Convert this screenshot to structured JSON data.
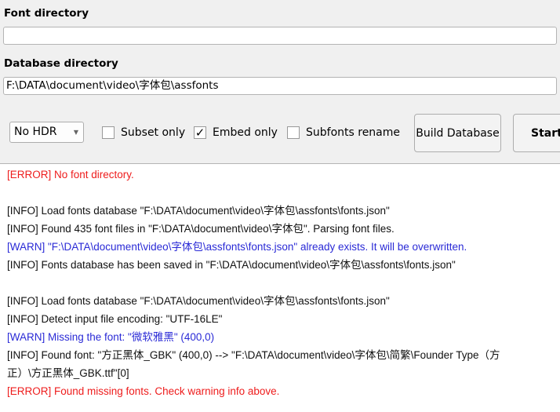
{
  "font_dir": {
    "label": "Font directory",
    "value": ""
  },
  "db_dir": {
    "label": "Database directory",
    "value": "F:\\DATA\\document\\video\\字体包\\assfonts"
  },
  "hdr": {
    "selected": "No HDR"
  },
  "options": [
    {
      "label": "Subset only",
      "checked": false
    },
    {
      "label": "Embed only",
      "checked": true
    },
    {
      "label": "Subfonts rename",
      "checked": false
    }
  ],
  "buttons": {
    "build": "Build Database",
    "start": "Start"
  },
  "colors": {
    "error": "#ee1c1c",
    "warn": "#2a2ad6"
  },
  "log": [
    {
      "level": "ERROR",
      "text": "[ERROR] No font directory."
    },
    {
      "level": "INFO",
      "text": ""
    },
    {
      "level": "INFO",
      "text": "[INFO] Load fonts database \"F:\\DATA\\document\\video\\字体包\\assfonts\\fonts.json\""
    },
    {
      "level": "INFO",
      "text": "[INFO] Found 435 font files in \"F:\\DATA\\document\\video\\字体包\". Parsing font files."
    },
    {
      "level": "WARN",
      "text": "[WARN] \"F:\\DATA\\document\\video\\字体包\\assfonts\\fonts.json\" already exists. It will be overwritten."
    },
    {
      "level": "INFO",
      "text": "[INFO] Fonts database has been saved in \"F:\\DATA\\document\\video\\字体包\\assfonts\\fonts.json\""
    },
    {
      "level": "INFO",
      "text": ""
    },
    {
      "level": "INFO",
      "text": "[INFO] Load fonts database \"F:\\DATA\\document\\video\\字体包\\assfonts\\fonts.json\""
    },
    {
      "level": "INFO",
      "text": "[INFO] Detect input file encoding:  \"UTF-16LE\""
    },
    {
      "level": "WARN",
      "text": "[WARN] Missing the font: \"微软雅黑\" (400,0)"
    },
    {
      "level": "INFO",
      "text": "[INFO] Found font: \"方正黑体_GBK\" (400,0) --> \"F:\\DATA\\document\\video\\字体包\\简繁\\Founder Type（方"
    },
    {
      "level": "INFO",
      "text": "正）\\方正黑体_GBK.ttf\"[0]"
    },
    {
      "level": "ERROR",
      "text": "[ERROR] Found missing fonts. Check warning info above."
    }
  ]
}
